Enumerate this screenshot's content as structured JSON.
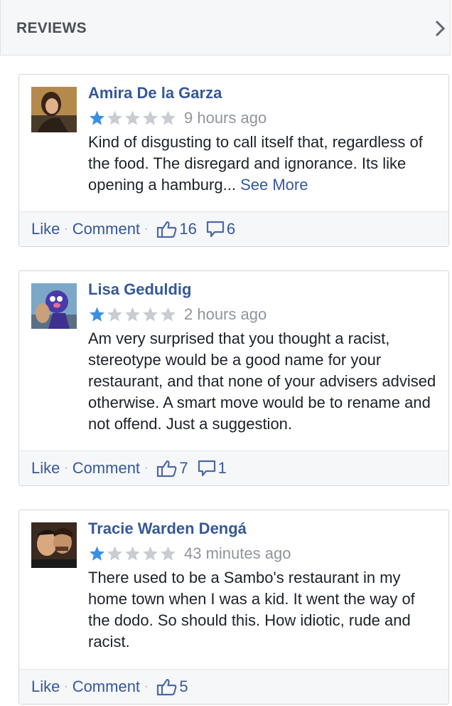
{
  "header": {
    "title": "REVIEWS"
  },
  "icons": {
    "star_filled": "#3b8fe2",
    "star_empty": "#c9ccd1",
    "link": "#365899"
  },
  "reviews": [
    {
      "name": "Amira De la Garza",
      "rating": 1,
      "max_rating": 5,
      "time": "9 hours ago",
      "text": "Kind of disgusting to call itself that, regardless of the food. The disregard and ignorance. Its like opening a hamburg...",
      "see_more": "See More",
      "like_label": "Like",
      "comment_label": "Comment",
      "likes": "16",
      "comments": "6"
    },
    {
      "name": "Lisa Geduldig",
      "rating": 1,
      "max_rating": 5,
      "time": "2 hours ago",
      "text": "Am very surprised that you thought a racist, stereotype would be a good name for your restaurant, and that none of your advisers advised otherwise. A smart move would be to rename and not offend. Just a suggestion.",
      "like_label": "Like",
      "comment_label": "Comment",
      "likes": "7",
      "comments": "1"
    },
    {
      "name": "Tracie Warden Dengá",
      "rating": 1,
      "max_rating": 5,
      "time": "43 minutes ago",
      "text": "There used to be a Sambo's restaurant in my home town when I was a kid. It went the way of the dodo. So should this. How idiotic, rude and racist.",
      "like_label": "Like",
      "comment_label": "Comment",
      "likes": "5"
    }
  ]
}
